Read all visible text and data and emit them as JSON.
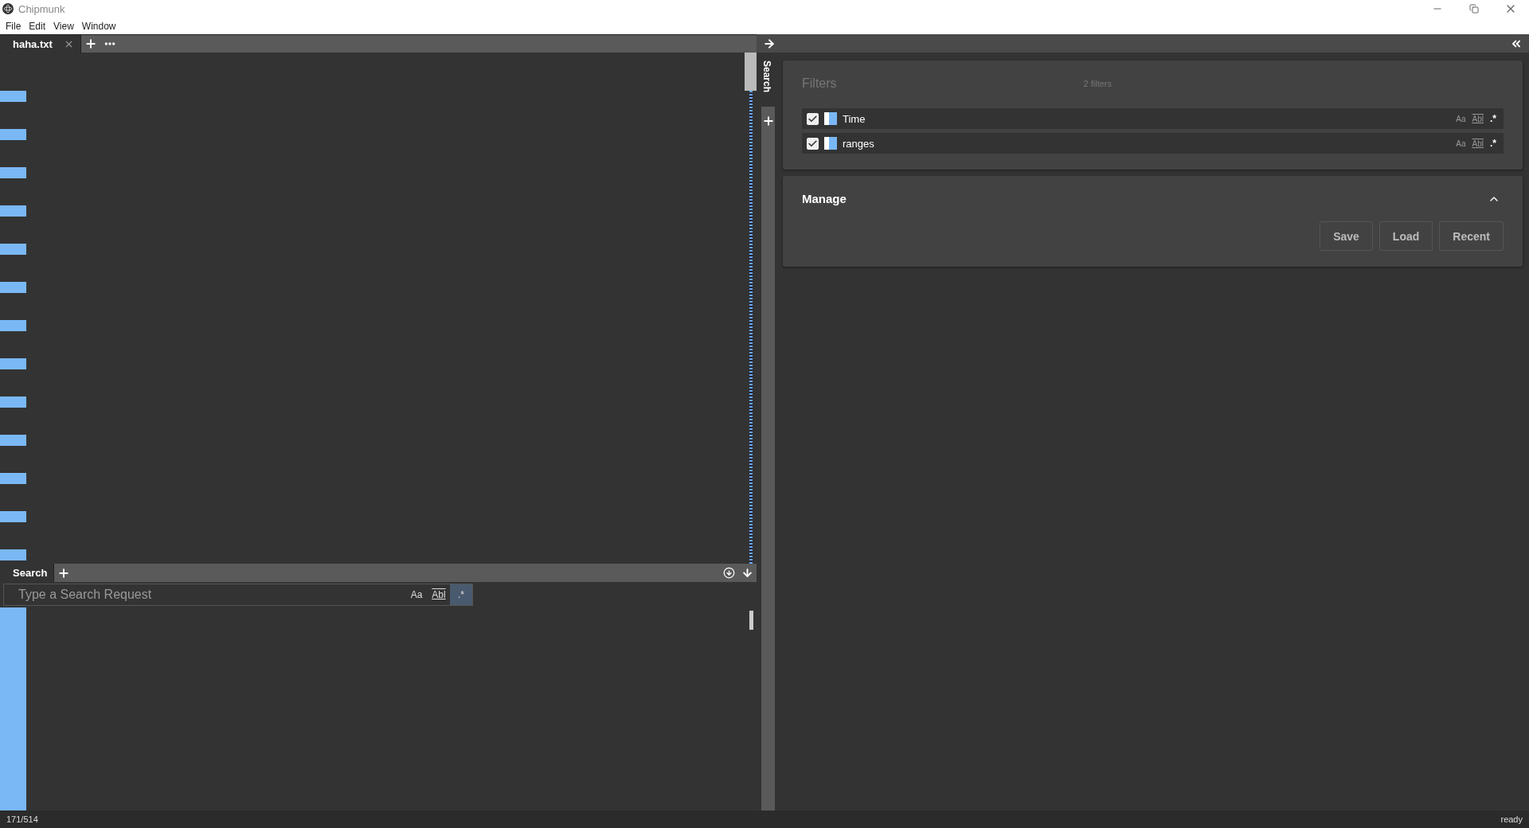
{
  "window": {
    "title": "Chipmunk"
  },
  "menu": [
    "File",
    "Edit",
    "View",
    "Window"
  ],
  "tabs": [
    {
      "label": "haha.txt",
      "selected": true
    }
  ],
  "search_panel": {
    "tabs": [
      {
        "label": "Search",
        "selected": true
      }
    ],
    "placeholder": "Type a Search Request",
    "options": [
      {
        "label": "Aa",
        "selected": false
      },
      {
        "label": "Abl",
        "selected": false
      },
      {
        "label": ".*",
        "selected": true
      }
    ]
  },
  "sidebar": {
    "tabs": [
      {
        "label": "Search",
        "selected": true
      }
    ]
  },
  "filters": {
    "title": "Filters",
    "count": "2 filters",
    "items": [
      {
        "label": "Time",
        "checked": true,
        "color": "#7ab8f5",
        "options": [
          "Aa",
          "Abl",
          ".*"
        ]
      },
      {
        "label": "ranges",
        "checked": true,
        "color": "#7ab8f5",
        "options": [
          "Aa",
          "Abl",
          ".*"
        ]
      }
    ]
  },
  "manage": {
    "title": "Manage",
    "expanded": true,
    "buttons": [
      "Save",
      "Load",
      "Recent"
    ]
  },
  "status_bar": {
    "position": "171/514",
    "state": "ready"
  }
}
